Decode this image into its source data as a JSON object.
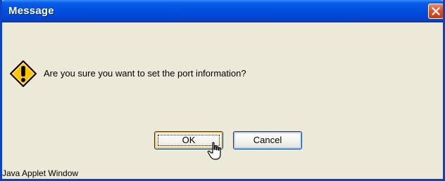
{
  "window": {
    "title": "Message",
    "close_icon": "close-icon"
  },
  "dialog": {
    "icon": "warning-icon",
    "message": "Are you sure you want to set the port information?",
    "ok_label": "OK",
    "cancel_label": "Cancel"
  },
  "status": {
    "text": "Java Applet Window"
  },
  "colors": {
    "titlebar": "#0352e0",
    "window_border": "#0a42c9",
    "client_bg": "#ece9d8",
    "close_button": "#d8542c",
    "warning_fill": "#ffc400",
    "default_button_focus": "#f5c76b",
    "button_hover": "#b7cdf3"
  }
}
